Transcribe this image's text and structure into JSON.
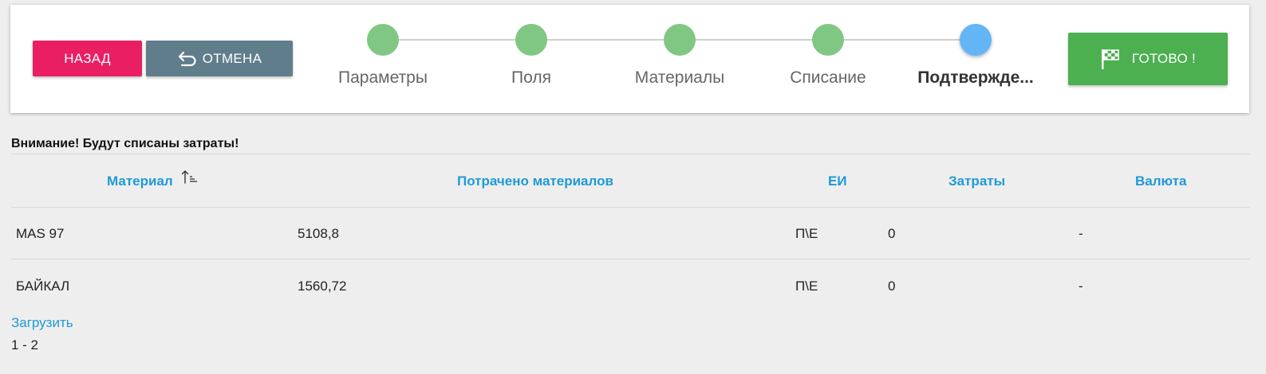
{
  "toolbar": {
    "back_label": "НАЗАД",
    "cancel_label": "ОТМЕНА",
    "done_label": "ГОТОВО !"
  },
  "steps": [
    {
      "label": "Параметры",
      "state": "completed"
    },
    {
      "label": "Поля",
      "state": "completed"
    },
    {
      "label": "Материалы",
      "state": "completed"
    },
    {
      "label": "Списание",
      "state": "completed"
    },
    {
      "label": "Подтвержде...",
      "state": "active"
    }
  ],
  "notice": "Внимание! Будут списаны затраты!",
  "table": {
    "columns": [
      "Материал",
      "Потрачено материалов",
      "ЕИ",
      "Затраты",
      "Валюта"
    ],
    "rows": [
      {
        "material": "MAS 97",
        "spent": "5108,8",
        "unit": "П\\Е",
        "cost": "0",
        "currency": "-"
      },
      {
        "material": "БАЙКАЛ",
        "spent": "1560,72",
        "unit": "П\\Е",
        "cost": "0",
        "currency": "-"
      }
    ]
  },
  "load_more_label": "Загрузить",
  "pager": "1 - 2",
  "colors": {
    "back": "#e91e63",
    "cancel": "#607d8b",
    "done": "#4caf50",
    "step_completed": "#81c784",
    "step_active": "#64b5f6",
    "link": "#1e9ad6"
  }
}
